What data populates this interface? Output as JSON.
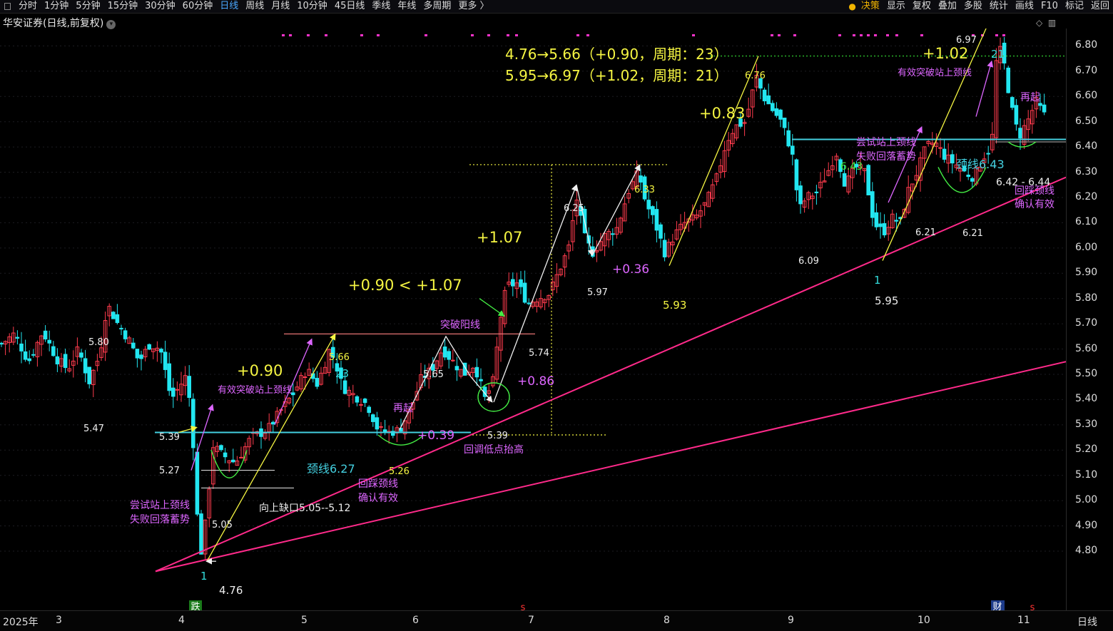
{
  "toolbar": {
    "periods": [
      "分时",
      "1分钟",
      "5分钟",
      "15分钟",
      "30分钟",
      "60分钟",
      "日线",
      "周线",
      "月线",
      "10分钟",
      "45日线",
      "季线",
      "年线",
      "多周期",
      "更多 〉"
    ],
    "active": "日线",
    "right": [
      "决策",
      "显示",
      "复权",
      "叠加",
      "多股",
      "统计",
      "画线",
      "F10",
      "标记",
      "返回"
    ]
  },
  "title": "华安证券(日线,前复权)",
  "price_axis": {
    "ticks": [
      "6.80",
      "6.70",
      "6.60",
      "6.50",
      "6.40",
      "6.30",
      "6.20",
      "6.10",
      "6.00",
      "5.90",
      "5.80",
      "5.70",
      "5.60",
      "5.50",
      "5.40",
      "5.30",
      "5.20",
      "5.10",
      "5.00",
      "4.90",
      "4.80"
    ]
  },
  "date_axis": {
    "labels": [
      "2025年",
      "3",
      "4",
      "5",
      "6",
      "7",
      "8",
      "9",
      "10",
      "11"
    ],
    "period_label": "日线"
  },
  "markers": {
    "die": "跌",
    "cai": "财",
    "s": "s"
  },
  "headline": [
    "4.76→5.66（+0.90，周期：23）",
    "5.95→6.97（+1.02，周期：21）"
  ],
  "annotations": {
    "gain_090": "+0.90",
    "gain_107": "+1.07",
    "compare": "+0.90 < +1.07",
    "gain_083": "+0.83",
    "gain_102": "+1.02",
    "gain_086": "+0.86",
    "gain_039": "+0.39",
    "gain_036": "+0.36",
    "neck1": "颈线6.27",
    "neck2": "颈线6.43",
    "neck2_left": "6.43",
    "gap": "向上缺口5.05--5.12",
    "try1": [
      "尝试站上颈线",
      "失败回落蓄势"
    ],
    "try2": [
      "尝试站上颈线",
      "失败回落蓄势"
    ],
    "eff1": "有效突破站上颈线",
    "eff2": "有效突破站上颈线",
    "back1": [
      "回踩颈线",
      "确认有效"
    ],
    "back2": [
      "回踩颈线",
      "确认有效"
    ],
    "break_yang": "突破阳线",
    "higher_low": "回调低点抬高",
    "reup1": "再起",
    "reup2": "再起",
    "count23": "23",
    "count21": "21",
    "count1a": "1",
    "count1b": "1",
    "range": "6.42 - 6.44"
  },
  "price_labels": [
    "5.80",
    "5.47",
    "5.39",
    "5.27",
    "4.76",
    "5.05",
    "5.66",
    "5.65",
    "5.26",
    "5.39",
    "5.74",
    "6.25",
    "5.97",
    "6.33",
    "5.93",
    "6.76",
    "6.09",
    "5.95",
    "6.21",
    "6.21",
    "6.97"
  ],
  "colors": {
    "up": "#ff3b4d",
    "down": "#22e6f0",
    "yellow": "#f5f542",
    "magenta": "#ff33cc",
    "violet": "#dd66ff",
    "cyan": "#33dddd",
    "neck": "#44d0e0"
  }
}
